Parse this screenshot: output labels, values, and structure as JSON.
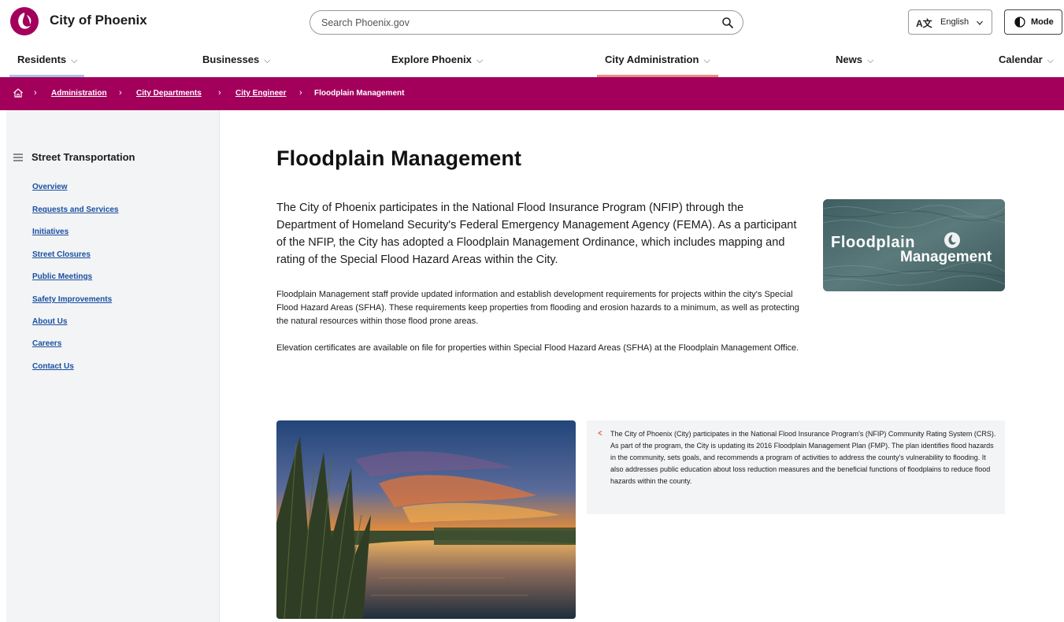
{
  "header": {
    "site_name": "City of Phoenix",
    "search_placeholder": "Search Phoenix.gov",
    "language_label": "English",
    "language_glyph": "A文",
    "mode_label": "Mode"
  },
  "nav": {
    "items": [
      {
        "label": "Residents"
      },
      {
        "label": "Businesses"
      },
      {
        "label": "Explore Phoenix"
      },
      {
        "label": "City Administration"
      },
      {
        "label": "News"
      },
      {
        "label": "Calendar"
      }
    ]
  },
  "breadcrumb": {
    "links": [
      "Administration",
      "City Departments",
      "City Engineer"
    ],
    "current": "Floodplain Management"
  },
  "sidebar": {
    "title": "Street Transportation",
    "links": [
      "Overview",
      "Requests and Services",
      "Initiatives",
      "Street Closures",
      "Public Meetings",
      "Safety Improvements",
      "About Us",
      "Careers",
      "Contact Us"
    ]
  },
  "main": {
    "title": "Floodplain Management",
    "lead": "The City of Phoenix participates in the National Flood Insurance Program (NFIP) through the Department of Homeland Security's Federal Emergency Management Agency (FEMA). As a participant of the NFIP, the City has adopted a Floodplain Management Ordinance, which includes mapping and rating of the Special Flood Hazard Areas within the City.",
    "para1": "Floodplain Management staff provide updated information and establish development requirements for projects within the city's Special Flood Hazard Areas (SFHA). These requirements keep properties from flooding and erosion hazards to a minimum, as well as protecting the natural resources within those flood prone areas.",
    "para2": "Elevation certificates are available on file for properties within Special Flood Hazard Areas (SFHA) at the Floodplain Management Office.",
    "logo_word1": "Floodplain",
    "logo_word2": "Management",
    "callout": "The City of Phoenix (City) participates in the National Flood Insurance Program's (NFIP) Community Rating System (CRS). As part of the program, the City is updating its 2016 Floodplain Management Plan (FMP). The plan identifies flood hazards in the community, sets goals, and recommends a program of activities to address the county's vulnerability to flooding. It also addresses public education about loss reduction measures and the beneficial functions of floodplains to reduce flood hazards within the county."
  },
  "colors": {
    "brand_magenta": "#a3005c",
    "link_blue": "#1a4fa0",
    "sidebar_bg": "#f3f4f6"
  }
}
